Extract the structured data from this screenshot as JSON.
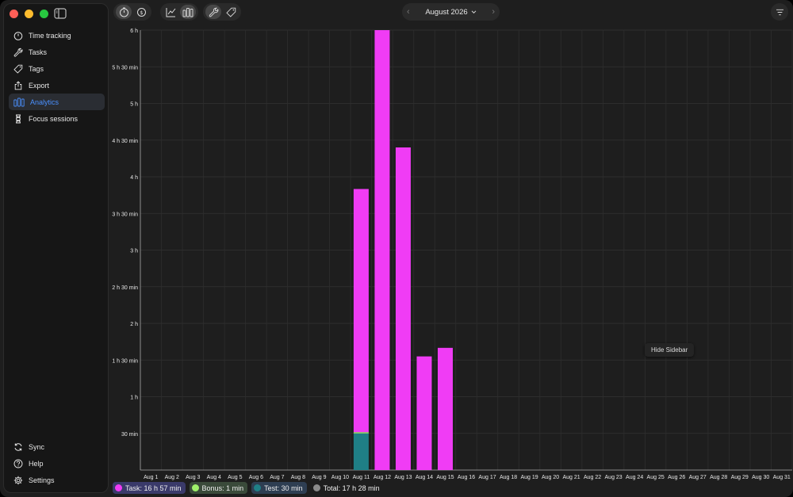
{
  "sidebar": {
    "items": [
      {
        "label": "Time tracking",
        "icon": "stopwatch-icon"
      },
      {
        "label": "Tasks",
        "icon": "wrench-icon"
      },
      {
        "label": "Tags",
        "icon": "tag-icon"
      },
      {
        "label": "Export",
        "icon": "export-icon"
      },
      {
        "label": "Analytics",
        "icon": "bar-chart-icon"
      },
      {
        "label": "Focus sessions",
        "icon": "hourglass-icon"
      }
    ],
    "active_index": 4,
    "bottom": [
      {
        "label": "Sync",
        "icon": "sync-icon"
      },
      {
        "label": "Help",
        "icon": "help-icon"
      },
      {
        "label": "Settings",
        "icon": "gear-icon"
      }
    ],
    "accent": "#4a90ff"
  },
  "toolbar": {
    "month": "August 2026"
  },
  "tooltip": "Hide Sidebar",
  "legend": [
    {
      "label": "Task: 16 h 57 min",
      "color": "#f03cf5"
    },
    {
      "label": "Bonus: 1 min",
      "color": "#9ef06a"
    },
    {
      "label": "Test: 30 min",
      "color": "#1f7f86"
    },
    {
      "label": "Total: 17 h 28 min",
      "color": "#8a8a8a"
    }
  ],
  "chart_data": {
    "type": "bar",
    "stacked": true,
    "categories": [
      "Aug 1",
      "Aug 2",
      "Aug 3",
      "Aug 4",
      "Aug 5",
      "Aug 6",
      "Aug 7",
      "Aug 8",
      "Aug 9",
      "Aug 10",
      "Aug 11",
      "Aug 12",
      "Aug 13",
      "Aug 14",
      "Aug 15",
      "Aug 16",
      "Aug 17",
      "Aug 18",
      "Aug 19",
      "Aug 20",
      "Aug 21",
      "Aug 22",
      "Aug 23",
      "Aug 24",
      "Aug 25",
      "Aug 26",
      "Aug 27",
      "Aug 28",
      "Aug 29",
      "Aug 30",
      "Aug 31"
    ],
    "yticks": [
      {
        "v": 30,
        "label": "30 min"
      },
      {
        "v": 60,
        "label": "1 h"
      },
      {
        "v": 90,
        "label": "1 h 30 min"
      },
      {
        "v": 120,
        "label": "2 h"
      },
      {
        "v": 150,
        "label": "2 h 30 min"
      },
      {
        "v": 180,
        "label": "3 h"
      },
      {
        "v": 210,
        "label": "3 h 30 min"
      },
      {
        "v": 240,
        "label": "4 h"
      },
      {
        "v": 270,
        "label": "4 h 30 min"
      },
      {
        "v": 300,
        "label": "5 h"
      },
      {
        "v": 330,
        "label": "5 h 30 min"
      },
      {
        "v": 360,
        "label": "6 h"
      }
    ],
    "ylim": [
      0,
      360
    ],
    "grid": true,
    "series": [
      {
        "name": "Test",
        "color": "#1f7f86",
        "values": [
          0,
          0,
          0,
          0,
          0,
          0,
          0,
          0,
          0,
          0,
          30,
          0,
          0,
          0,
          0,
          0,
          0,
          0,
          0,
          0,
          0,
          0,
          0,
          0,
          0,
          0,
          0,
          0,
          0,
          0,
          0
        ]
      },
      {
        "name": "Bonus",
        "color": "#9ef06a",
        "values": [
          0,
          0,
          0,
          0,
          0,
          0,
          0,
          0,
          0,
          0,
          1,
          0,
          0,
          0,
          0,
          0,
          0,
          0,
          0,
          0,
          0,
          0,
          0,
          0,
          0,
          0,
          0,
          0,
          0,
          0,
          0
        ]
      },
      {
        "name": "Task",
        "color": "#f03cf5",
        "values": [
          0,
          0,
          0,
          0,
          0,
          0,
          0,
          0,
          0,
          0,
          199,
          360,
          264,
          93,
          100,
          0,
          0,
          0,
          0,
          0,
          0,
          0,
          0,
          0,
          0,
          0,
          0,
          0,
          0,
          0,
          0
        ]
      }
    ]
  }
}
